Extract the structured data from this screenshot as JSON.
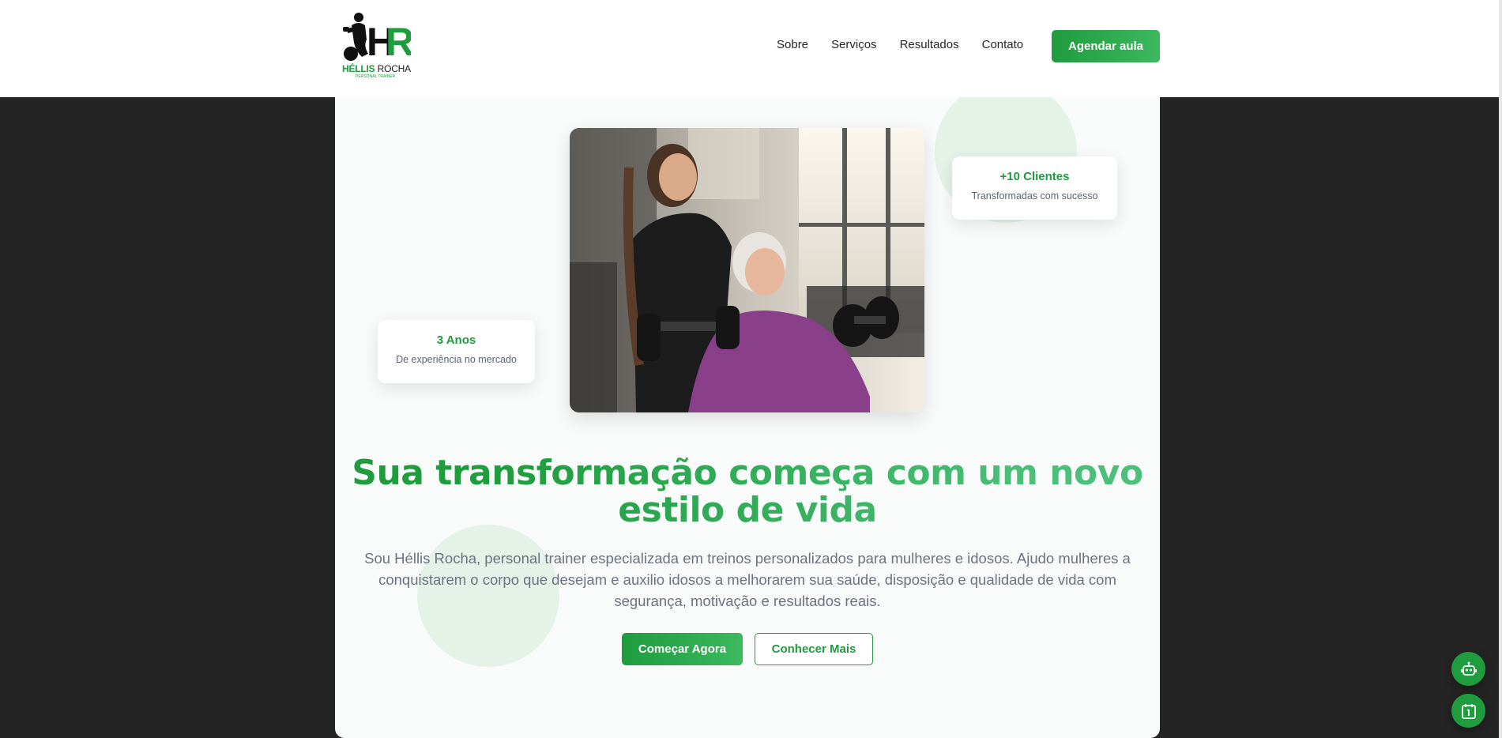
{
  "brand": {
    "logo_initials": "HR",
    "logo_name_first": "HÉLLIS",
    "logo_name_last": "ROCHA",
    "logo_subtitle": "PERSONAL TRAINER"
  },
  "nav": {
    "items": [
      "Sobre",
      "Serviços",
      "Resultados",
      "Contato"
    ],
    "cta_label": "Agendar aula"
  },
  "hero": {
    "stats": {
      "clients_value": "+10 Clientes",
      "clients_label": "Transformadas com sucesso",
      "years_value": "3 Anos",
      "years_label": "De experiência no mercado"
    },
    "headline_line1": "Sua transformação começa com um novo",
    "headline_line2": "estilo de vida",
    "lead": "Sou Héllis Rocha, personal trainer especializada em treinos personalizados para mulheres e idosos. Ajudo mulheres a conquistarem o corpo que desejam e auxilio idosos a melhorarem sua saúde, disposição e qualidade de vida com segurança, motivação e resultados reais.",
    "primary_button": "Começar Agora",
    "secondary_button": "Conhecer Mais"
  },
  "colors": {
    "brand_green": "#1e9c3e",
    "brand_green_light": "#4cc07a",
    "page_background": "#242424"
  },
  "icons": {
    "floating_top": "robot-icon",
    "floating_bottom": "calendar-icon"
  }
}
